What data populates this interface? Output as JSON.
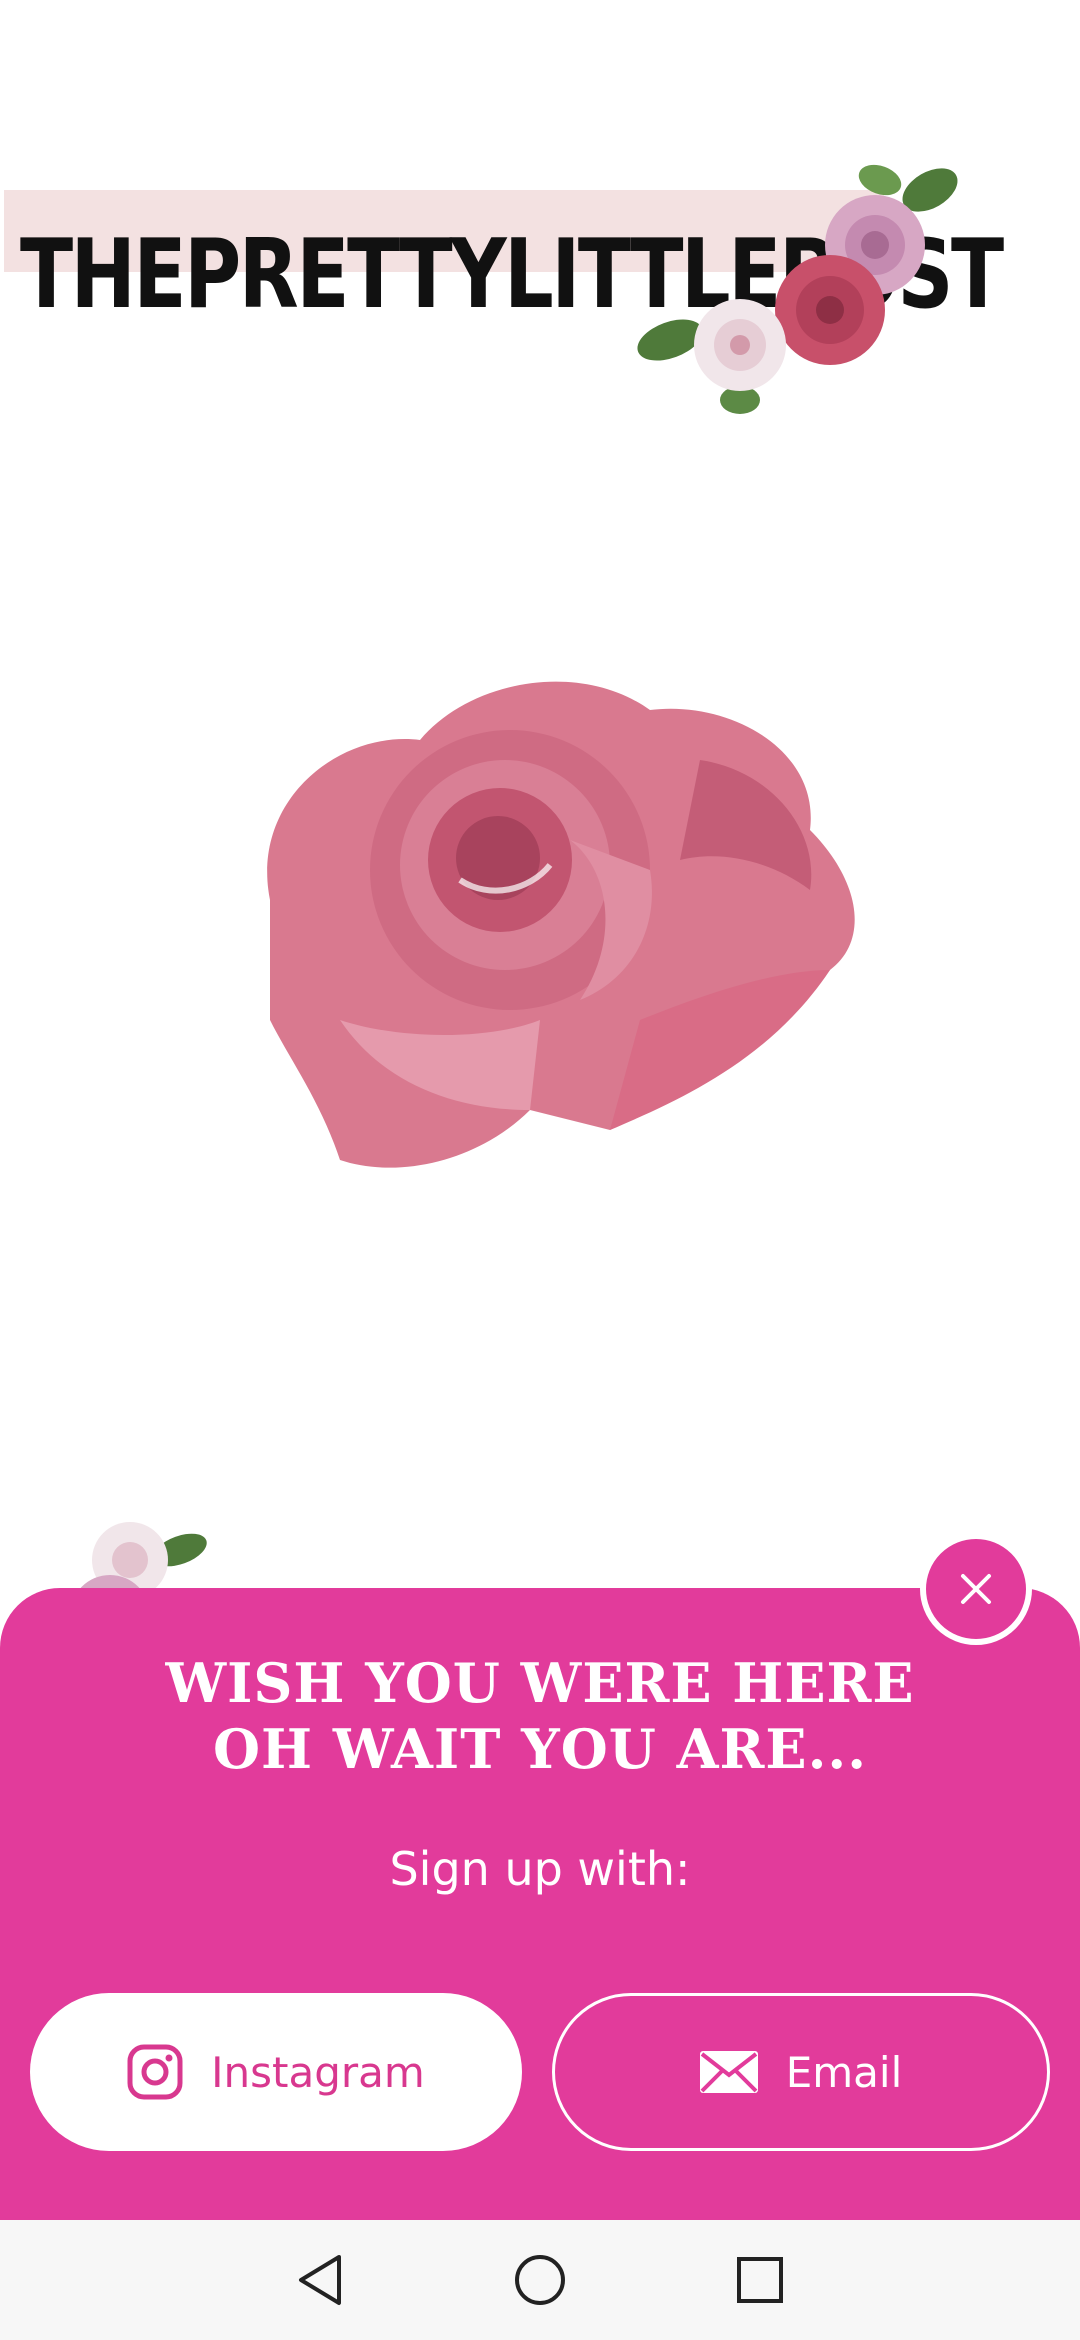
{
  "brand": {
    "logo_text": "THEPRETTYLITTLEPOST"
  },
  "popup": {
    "headline_line1": "WISH YOU WERE HERE",
    "headline_line2": "OH WAIT YOU ARE...",
    "signup_label": "Sign up with:",
    "instagram_label": "Instagram",
    "email_label": "Email",
    "close_icon": "close-icon",
    "accent_color": "#e23b9b"
  },
  "navbar": {
    "icons": [
      "back-icon",
      "home-icon",
      "recents-icon"
    ]
  }
}
